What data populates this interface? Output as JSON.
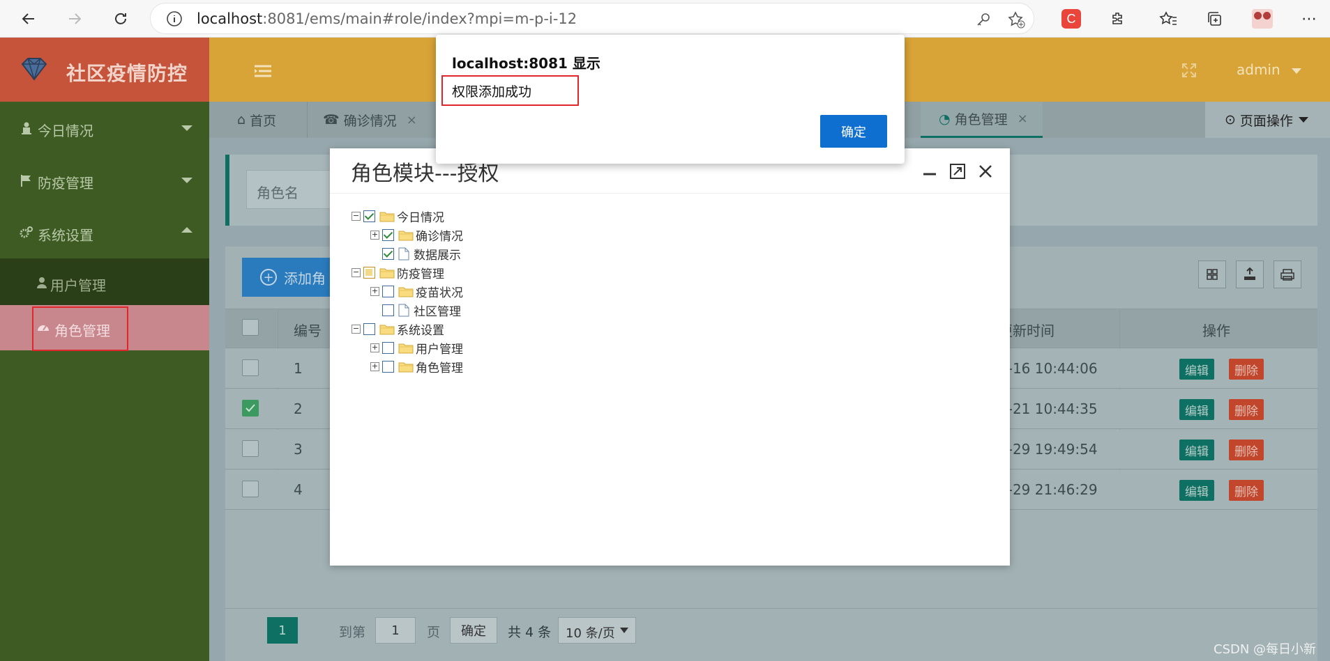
{
  "browser": {
    "url_host": "localhost",
    "url_rest": ":8081/ems/main#role/index?mpi=m-p-i-12"
  },
  "app": {
    "logo_text": "社区疫情防控",
    "user": "admin"
  },
  "sidebar": {
    "items": [
      {
        "label": "今日情况"
      },
      {
        "label": "防疫管理"
      },
      {
        "label": "系统设置"
      }
    ],
    "sub_items": [
      {
        "label": "用户管理"
      },
      {
        "label": "角色管理"
      }
    ]
  },
  "tabs": [
    {
      "label": "首页"
    },
    {
      "label": "确诊情况"
    },
    {
      "label": "角色管理"
    }
  ],
  "page_ops": "页面操作",
  "search": {
    "placeholder": "角色名"
  },
  "toolbar": {
    "add_label": "添加角"
  },
  "table": {
    "headers": {
      "id": "编号",
      "updated": "更新时间",
      "actions": "操作"
    },
    "rows": [
      {
        "id": "1",
        "updated": "0-16 10:44:06",
        "checked": false
      },
      {
        "id": "2",
        "updated": "0-21 10:44:35",
        "checked": true
      },
      {
        "id": "3",
        "updated": "0-29 19:49:54",
        "checked": false
      },
      {
        "id": "4",
        "updated": "0-29 21:46:29",
        "checked": false
      }
    ],
    "edit_label": "编辑",
    "delete_label": "删除"
  },
  "pager": {
    "current": "1",
    "goto_label": "到第",
    "goto_value": "1",
    "page_unit": "页",
    "confirm": "确定",
    "total": "共 4 条",
    "page_size": "10 条/页"
  },
  "dialog": {
    "title": "角色模块---授权",
    "tree": [
      {
        "label": "今日情况",
        "level": 0,
        "toggle": "−",
        "state": "checked",
        "type": "folder"
      },
      {
        "label": "确诊情况",
        "level": 1,
        "toggle": "+",
        "state": "checked",
        "type": "folder"
      },
      {
        "label": "数据展示",
        "level": 1,
        "toggle": "",
        "state": "checked",
        "type": "doc"
      },
      {
        "label": "防疫管理",
        "level": 0,
        "toggle": "−",
        "state": "partial",
        "type": "folder"
      },
      {
        "label": "疫苗状况",
        "level": 1,
        "toggle": "+",
        "state": "unchecked",
        "type": "folder"
      },
      {
        "label": "社区管理",
        "level": 1,
        "toggle": "",
        "state": "unchecked",
        "type": "doc"
      },
      {
        "label": "系统设置",
        "level": 0,
        "toggle": "−",
        "state": "unchecked",
        "type": "folder"
      },
      {
        "label": "用户管理",
        "level": 1,
        "toggle": "+",
        "state": "unchecked",
        "type": "folder"
      },
      {
        "label": "角色管理",
        "level": 1,
        "toggle": "+",
        "state": "unchecked",
        "type": "folder"
      }
    ]
  },
  "alert": {
    "title": "localhost:8081 显示",
    "message": "权限添加成功",
    "ok": "确定"
  },
  "watermark": "CSDN @每日小新",
  "colors": {
    "accent_teal": "#0e6f63",
    "danger": "#c1462b",
    "alert_button": "#0f6fd0"
  }
}
